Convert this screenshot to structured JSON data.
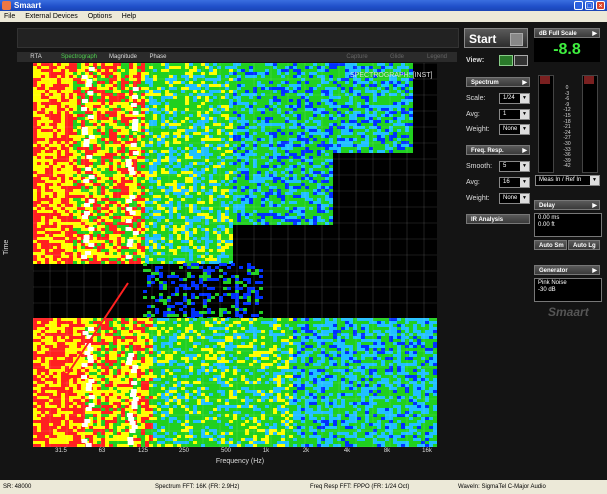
{
  "window": {
    "title": "Smaart"
  },
  "menu": [
    "File",
    "External Devices",
    "Options",
    "Help"
  ],
  "tabs": [
    {
      "label": "RTA",
      "state": "normal"
    },
    {
      "label": "Spectrograph",
      "state": "active"
    },
    {
      "label": "Magnitude",
      "state": "normal"
    },
    {
      "label": "Phase",
      "state": "normal"
    },
    {
      "label": "Capture",
      "state": "dim"
    },
    {
      "label": "Glide",
      "state": "dim"
    },
    {
      "label": "Legend",
      "state": "dim"
    }
  ],
  "plot": {
    "overlay_label": "SPECTROGRAPH: [INST]",
    "y_label": "Time",
    "x_label": "Frequency (Hz)",
    "x_ticks": [
      "31.5",
      "63",
      "125",
      "250",
      "500",
      "1k",
      "2k",
      "4k",
      "8k",
      "16k"
    ],
    "colors": {
      "hot": "#ff2020",
      "warm": "#ffff00",
      "mid": "#20d020",
      "cool": "#20c0ff",
      "cold": "#0030ff",
      "peak": "#ffffff"
    }
  },
  "controls": {
    "start_label": "Start",
    "db_full_scale_label": "dB Full Scale",
    "db_value": "-8.8",
    "view_label": "View:",
    "spectrum_label": "Spectrum",
    "scale_label": "Scale:",
    "scale_value": "1/24",
    "avg_label": "Avg:",
    "avg_value": "1",
    "weight_label": "Weight:",
    "weight_value": "None",
    "freq_resp_label": "Freq. Resp.",
    "smooth_label": "Smooth:",
    "smooth_value": "5",
    "fr_avg_label": "Avg:",
    "fr_avg_value": "16",
    "fr_weight_label": "Weight:",
    "fr_weight_value": "None",
    "ir_analysis_label": "IR Analysis",
    "meter_select_value": "Meas In / Ref In",
    "delay_label": "Delay",
    "delay_ms": "0.00 ms",
    "delay_ft": "0.00 ft",
    "auto_sm_label": "Auto Sm",
    "auto_lg_label": "Auto Lg",
    "generator_label": "Generator",
    "generator_type": "Pink Noise",
    "generator_level": "-30 dB",
    "meter_scale": [
      "0",
      "-3",
      "-6",
      "-9",
      "-12",
      "-15",
      "-18",
      "-21",
      "-24",
      "-27",
      "-30",
      "-33",
      "-36",
      "-39",
      "-42"
    ],
    "logo": "Smaart"
  },
  "status": {
    "sr": "SR: 48000",
    "spectrum_fft": "Spectrum FFT: 16K (FR: 2.9Hz)",
    "freq_resp_fft": "Freq Resp FFT: FPPO (FR: 1/24 Oct)",
    "wave_in": "WaveIn: SigmaTel C-Major Audio"
  }
}
